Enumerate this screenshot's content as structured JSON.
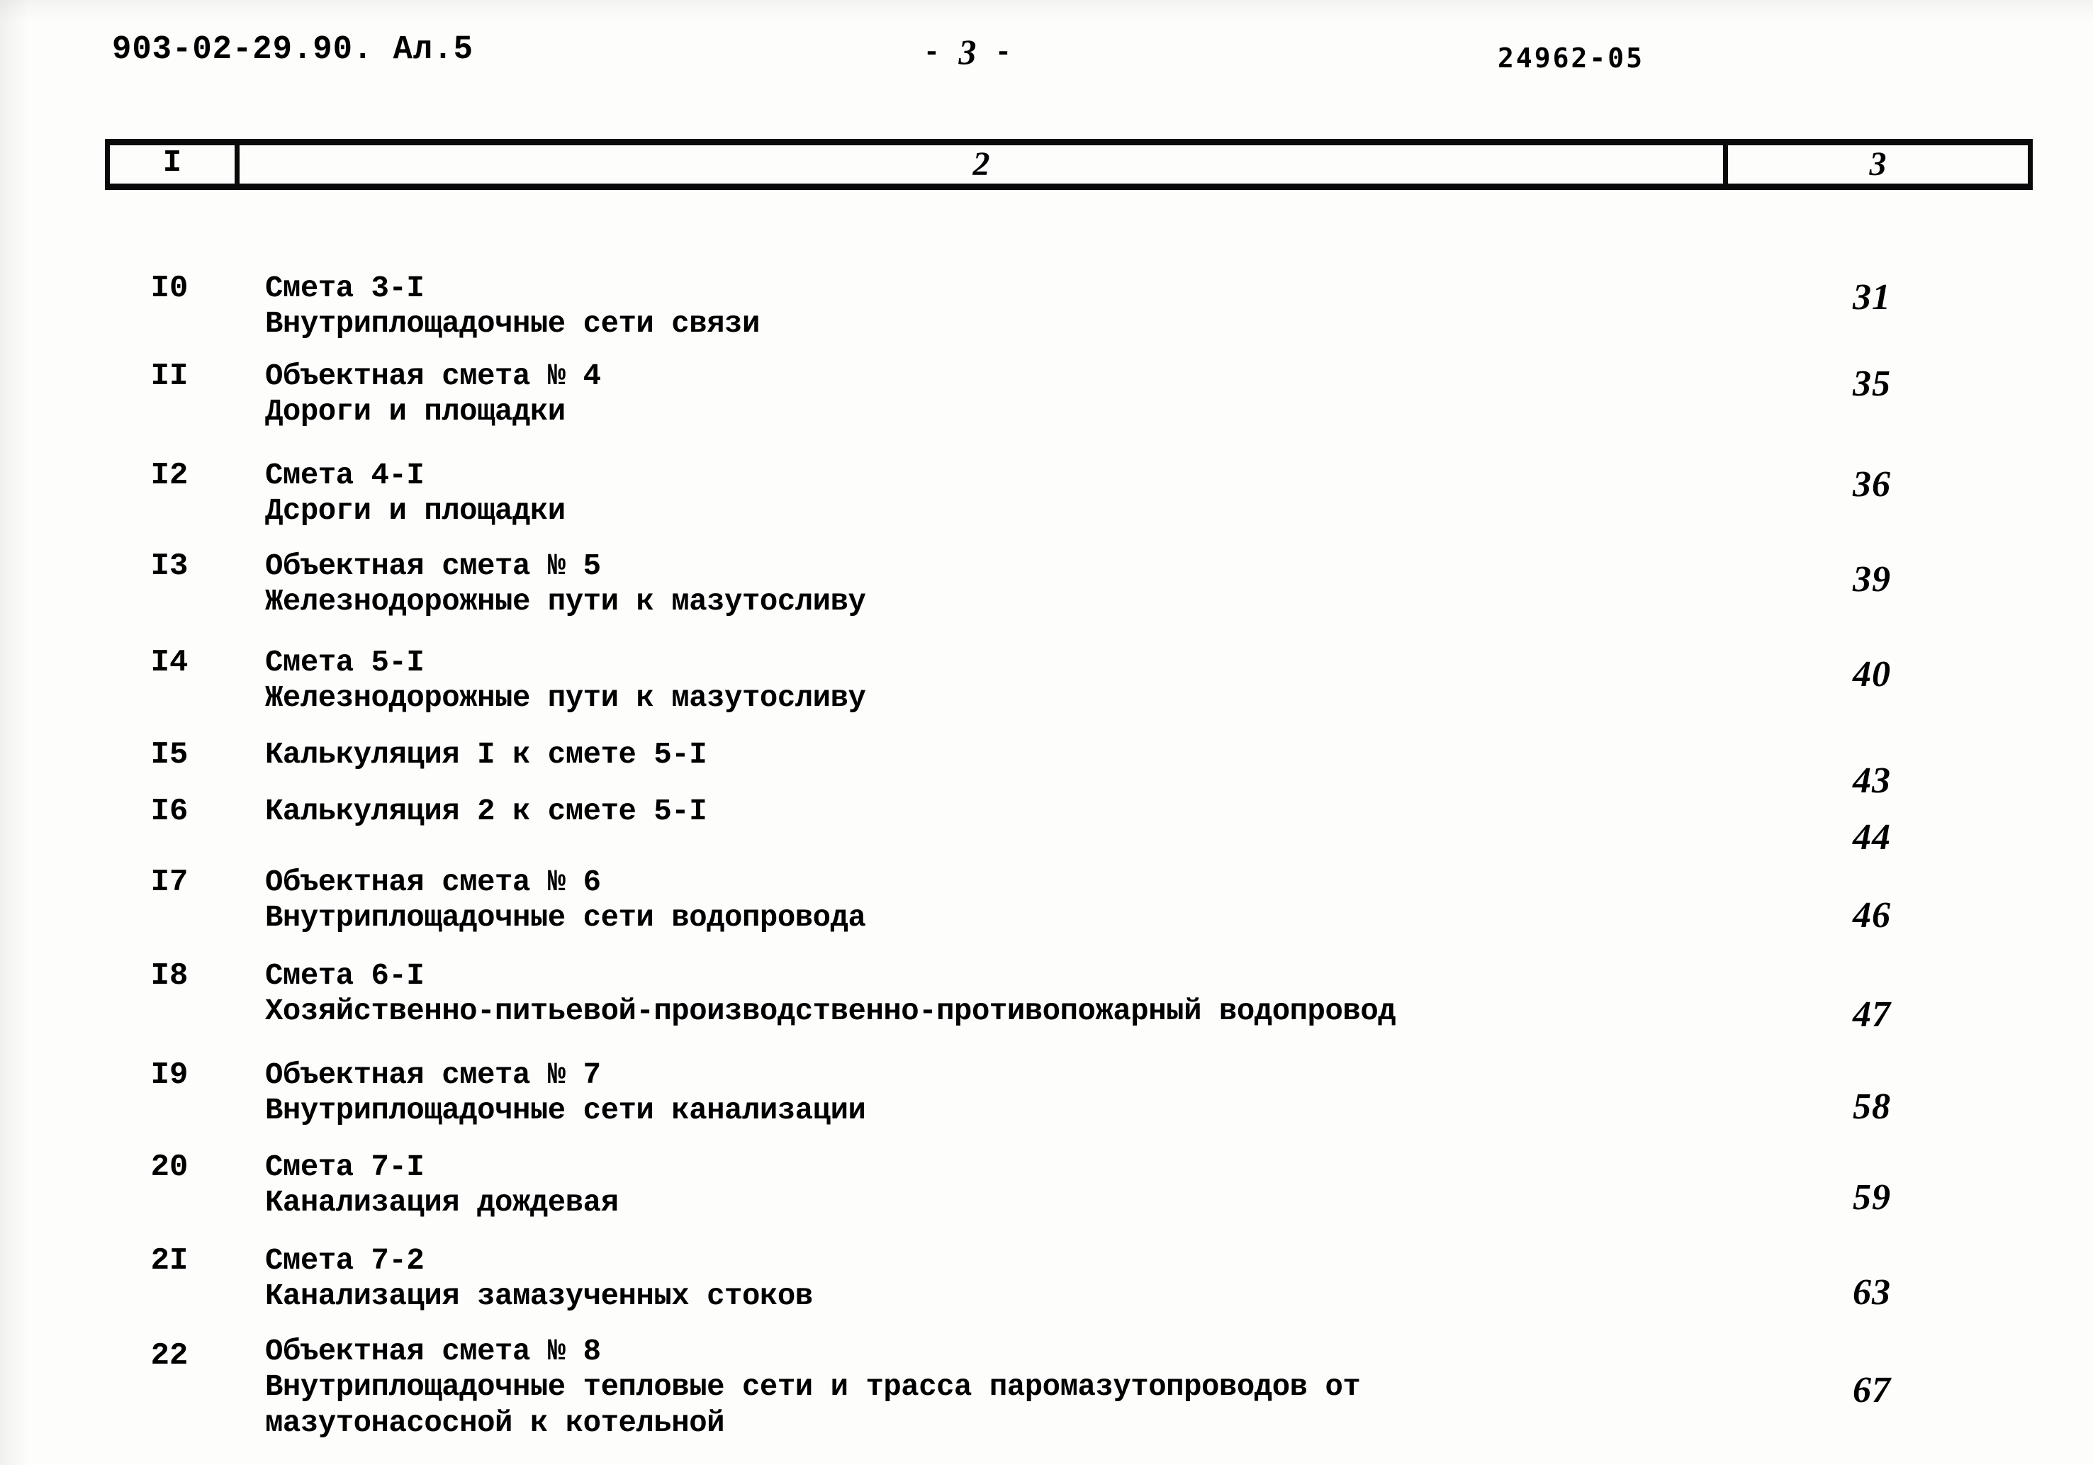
{
  "header": {
    "doc_code": "903-02-29.90. Ал.5",
    "page_marker_dash_left": "-",
    "page_marker_number": "3",
    "page_marker_dash_right": "-",
    "archive_stamp": "24962-05"
  },
  "table": {
    "columns": [
      {
        "key": "num",
        "header": "I",
        "style": "roman"
      },
      {
        "key": "desc",
        "header": "2",
        "style": "hand"
      },
      {
        "key": "page",
        "header": "3",
        "style": "hand"
      }
    ],
    "rows": [
      {
        "num": "I0",
        "lines": [
          "Смета 3-I",
          "Внутриплощадочные сети связи"
        ],
        "page": "31"
      },
      {
        "num": "II",
        "lines": [
          "Объектная смета № 4",
          "Дороги и площадки"
        ],
        "page": "35"
      },
      {
        "num": "I2",
        "lines": [
          "Смета 4-I",
          "Дсроги и площадки"
        ],
        "page": "36"
      },
      {
        "num": "I3",
        "lines": [
          "Объектная смета № 5",
          "Железнодорожные пути к мазутосливу"
        ],
        "page": "39"
      },
      {
        "num": "I4",
        "lines": [
          "Смета 5-I",
          "Железнодорожные пути к мазутосливу"
        ],
        "page": "40"
      },
      {
        "num": "I5",
        "lines": [
          "Калькуляция I к смете 5-I"
        ],
        "page": "43"
      },
      {
        "num": "I6",
        "lines": [
          "Калькуляция 2 к смете 5-I"
        ],
        "page": "44"
      },
      {
        "num": "I7",
        "lines": [
          "Объектная смета № 6",
          "Внутриплощадочные сети водопровода"
        ],
        "page": "46"
      },
      {
        "num": "I8",
        "lines": [
          "Смета 6-I",
          "Хозяйственно-питьевой-производственно-противопожарный водопровод"
        ],
        "page": "47"
      },
      {
        "num": "I9",
        "lines": [
          "Объектная смета № 7",
          "Внутриплощадочные сети канализации"
        ],
        "page": "58"
      },
      {
        "num": "20",
        "lines": [
          "Смета 7-I",
          "Канализация дождевая"
        ],
        "page": "59"
      },
      {
        "num": "2I",
        "lines": [
          "Смета 7-2",
          "Канализация замазученных стоков"
        ],
        "page": "63"
      },
      {
        "num": "22",
        "lines": [
          "Объектная смета № 8",
          "Внутриплощадочные тепловые сети и трасса паромазутопроводов от мазутонасосной к котельной"
        ],
        "page": "67"
      }
    ]
  },
  "layout": {
    "row_tops": [
      310,
      434,
      574,
      702,
      838,
      968,
      1048,
      1148,
      1280,
      1420,
      1550,
      1682,
      1810
    ],
    "page_tops": [
      318,
      440,
      582,
      716,
      850,
      1000,
      1080,
      1190,
      1330,
      1460,
      1588,
      1722,
      1860
    ],
    "num_tops": [
      310,
      434,
      574,
      702,
      838,
      968,
      1048,
      1148,
      1280,
      1420,
      1550,
      1682,
      1816
    ],
    "desc_widths": [
      2060,
      2060,
      2060,
      2060,
      2060,
      2060,
      2060,
      2060,
      2060,
      2060,
      2060,
      2060,
      1840
    ]
  },
  "colors": {
    "ink": "#0a0a0a",
    "paper": "#fdfdfc"
  }
}
